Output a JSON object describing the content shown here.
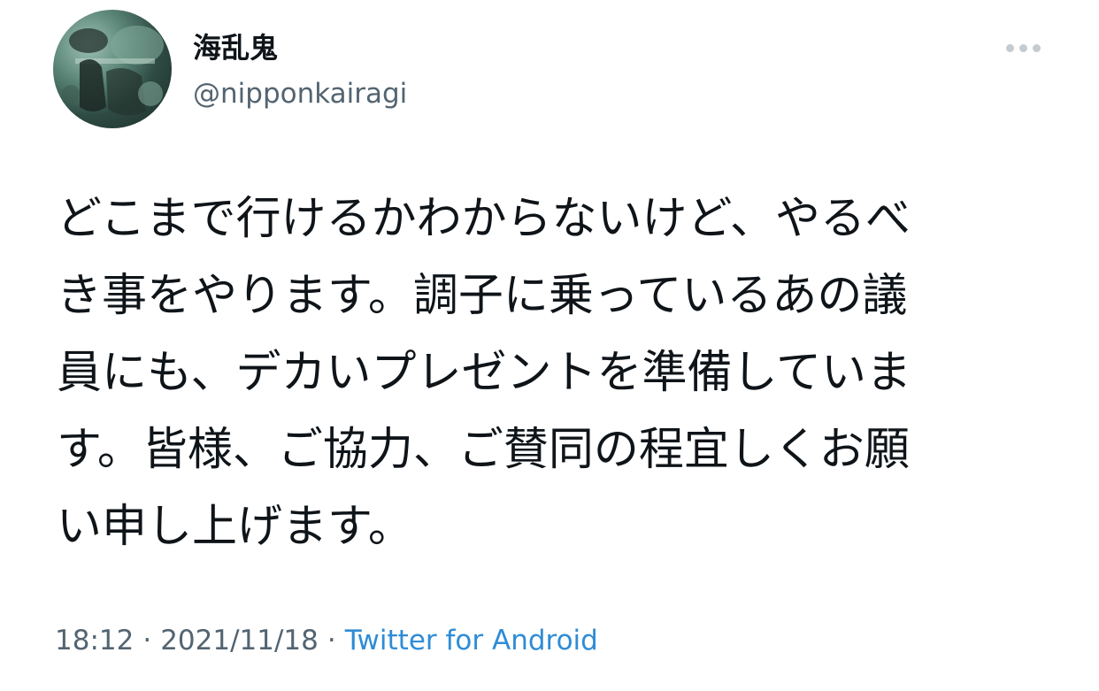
{
  "tweet": {
    "author": {
      "display_name": "海乱鬼",
      "handle": "@nipponkairagi",
      "avatar_icon": "avatar-photo"
    },
    "more_icon": "more-horizontal-icon",
    "text_lines": [
      "どこまで行けるかわからないけど、やるべ",
      "き事をやります。調子に乗っているあの議",
      "員にも、デカいプレゼントを準備していま",
      "す。皆様、ご協力、ご賛同の程宜しくお願",
      "い申し上げます。"
    ],
    "meta": {
      "time": "18:12",
      "separator": "·",
      "date": "2021/11/18",
      "source": "Twitter for Android"
    }
  },
  "colors": {
    "text_primary": "#0f1419",
    "text_secondary": "#536471",
    "link": "#2f8cd6",
    "more_dots": "#c4cbd1"
  }
}
